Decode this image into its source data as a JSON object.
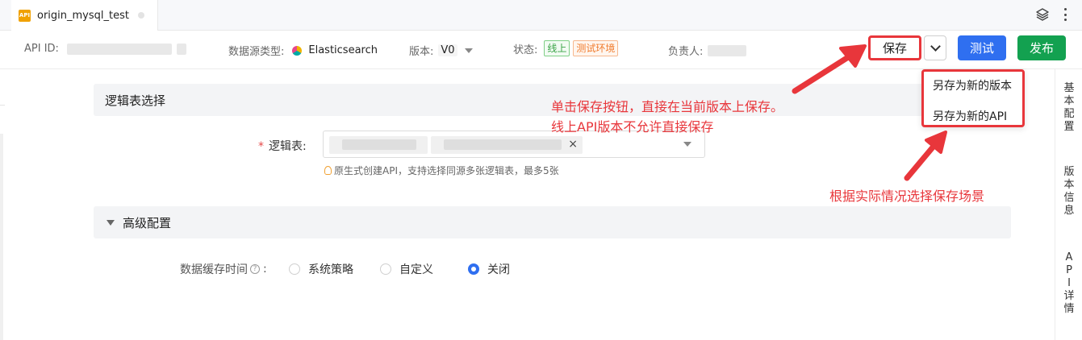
{
  "tab": {
    "icon_text": "API",
    "title": "origin_mysql_test"
  },
  "toolbar_icons": {
    "layers": "layers-icon",
    "more": "more-vertical-icon"
  },
  "info": {
    "api_id_label": "API ID:",
    "datasource_label": "数据源类型:",
    "datasource_value": "Elasticsearch",
    "version_label": "版本:",
    "version_value": "V0",
    "status_label": "状态:",
    "status_tags": [
      "线上",
      "测试环境"
    ],
    "owner_label": "负责人:"
  },
  "buttons": {
    "save": "保存",
    "test": "测试",
    "publish": "发布"
  },
  "save_menu": {
    "items": [
      "另存为新的版本",
      "另存为新的API"
    ]
  },
  "section_logic": {
    "title": "逻辑表选择",
    "field_required_mark": "*",
    "field_label": "逻辑表:",
    "chip_remove": "×",
    "hint": "原生式创建API，支持选择同源多张逻辑表，最多5张"
  },
  "section_advanced": {
    "title": "高级配置",
    "cache_label": "数据缓存时间",
    "help_mark": "?",
    "colon": ":",
    "options": [
      "系统策略",
      "自定义",
      "关闭"
    ],
    "selected_option": "关闭"
  },
  "side_nav": {
    "items": [
      {
        "label": [
          "基",
          "本",
          "配",
          "置"
        ]
      },
      {
        "label": [
          "版",
          "本",
          "信",
          "息"
        ]
      },
      {
        "label": [
          "A",
          "P",
          "I",
          "详",
          "情"
        ]
      }
    ]
  },
  "annotations": {
    "save_note_line1": "单击保存按钮，直接在当前版本上保存。",
    "save_note_line2": "线上API版本不允许直接保存",
    "menu_note": "根据实际情况选择保存场景"
  },
  "colors": {
    "primary": "#2f6ff0",
    "publish": "#13a150",
    "annotation_red": "#e8363b",
    "tag_green": "#3aa346",
    "tag_orange": "#f07a2b"
  }
}
